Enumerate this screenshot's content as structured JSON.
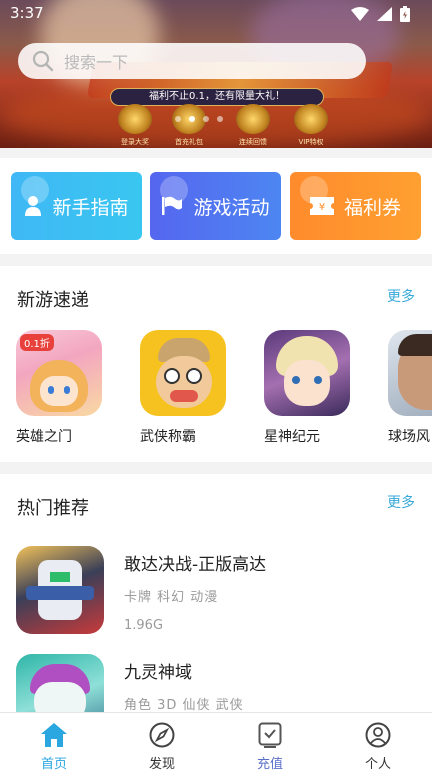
{
  "status_bar": {
    "time": "3:37"
  },
  "banner": {
    "slogan": "福利不止0.1，还有限量大礼！",
    "medals": [
      "登录大奖",
      "首充礼包",
      "连续回馈",
      "VIP特权"
    ],
    "carousel_dots": 4,
    "carousel_active": 1
  },
  "search": {
    "placeholder": "搜索一下"
  },
  "quick_actions": [
    {
      "label": "新手指南",
      "icon": "user-icon"
    },
    {
      "label": "游戏活动",
      "icon": "flag-icon"
    },
    {
      "label": "福利券",
      "icon": "ticket-icon"
    }
  ],
  "new_games": {
    "title": "新游速递",
    "more": "更多",
    "items": [
      {
        "name": "英雄之门",
        "badge": "0.1折"
      },
      {
        "name": "武侠称霸"
      },
      {
        "name": "星神纪元"
      },
      {
        "name": "球场风"
      }
    ]
  },
  "hot": {
    "title": "热门推荐",
    "more": "更多",
    "items": [
      {
        "title": "敢达决战-正版高达",
        "tags": "卡牌 科幻 动漫",
        "size": "1.96G"
      },
      {
        "title": "九灵神域",
        "tags": "角色 3D 仙侠 武侠",
        "size": ""
      }
    ]
  },
  "tabs": [
    {
      "label": "首页",
      "icon": "home-icon"
    },
    {
      "label": "发现",
      "icon": "compass-icon"
    },
    {
      "label": "充值",
      "icon": "recharge-icon"
    },
    {
      "label": "个人",
      "icon": "person-icon"
    }
  ],
  "colors": {
    "accent": "#2aa6e0",
    "quick_blue": "#3fb8f5",
    "quick_indigo": "#5566ef",
    "quick_orange": "#ff8b2c",
    "more_link": "#37a9d9"
  }
}
